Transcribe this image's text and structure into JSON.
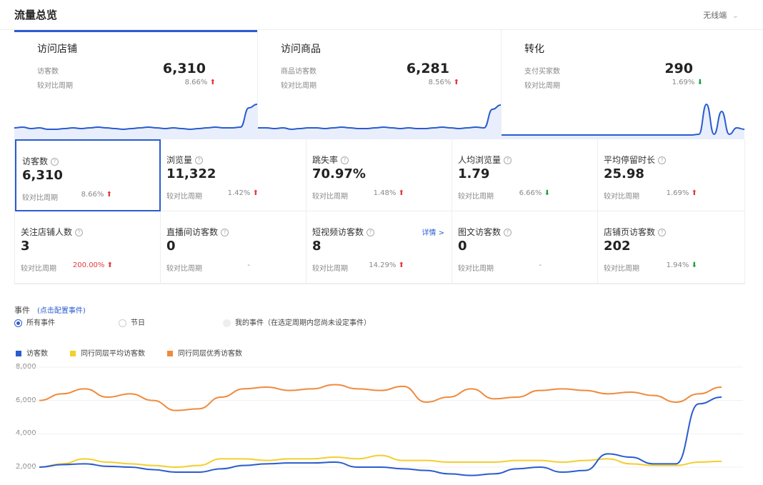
{
  "header": {
    "title": "流量总览",
    "device": "无线端"
  },
  "cards": [
    {
      "title": "访问店铺",
      "label": "访客数",
      "value": "6,310",
      "compare": "较对比周期",
      "pct": "8.66%",
      "dir": "up"
    },
    {
      "title": "访问商品",
      "label": "商品访客数",
      "value": "6,281",
      "compare": "较对比周期",
      "pct": "8.56%",
      "dir": "up"
    },
    {
      "title": "转化",
      "label": "支付买家数",
      "value": "290",
      "compare": "较对比周期",
      "pct": "1.69%",
      "dir": "down"
    }
  ],
  "metrics": [
    {
      "name": "访客数",
      "value": "6,310",
      "compare": "较对比周期",
      "pct": "8.66%",
      "dir": "up"
    },
    {
      "name": "浏览量",
      "value": "11,322",
      "compare": "较对比周期",
      "pct": "1.42%",
      "dir": "up"
    },
    {
      "name": "跳失率",
      "value": "70.97%",
      "compare": "较对比周期",
      "pct": "1.48%",
      "dir": "up"
    },
    {
      "name": "人均浏览量",
      "value": "1.79",
      "compare": "较对比周期",
      "pct": "6.66%",
      "dir": "down"
    },
    {
      "name": "平均停留时长",
      "value": "25.98",
      "compare": "较对比周期",
      "pct": "1.69%",
      "dir": "up"
    },
    {
      "name": "关注店铺人数",
      "value": "3",
      "compare": "较对比周期",
      "pct": "200.00%",
      "dir": "up"
    },
    {
      "name": "直播间访客数",
      "value": "0",
      "compare": "较对比周期",
      "pct": "-",
      "dir": "none"
    },
    {
      "name": "短视频访客数",
      "value": "8",
      "compare": "较对比周期",
      "pct": "14.29%",
      "dir": "up",
      "detail": "详情 >"
    },
    {
      "name": "图文访客数",
      "value": "0",
      "compare": "较对比周期",
      "pct": "-",
      "dir": "none"
    },
    {
      "name": "店铺页访客数",
      "value": "202",
      "compare": "较对比周期",
      "pct": "1.94%",
      "dir": "down"
    }
  ],
  "events": {
    "label": "事件",
    "link": "(点击配置事件)",
    "options": [
      "所有事件",
      "节日",
      "我的事件（在选定周期内您尚未设定事件）"
    ]
  },
  "colors": {
    "blue": "#2a5ccf",
    "yellow": "#f2cf2e",
    "orange": "#f08a3c",
    "up": "#e0393e",
    "down": "#1a9d3c"
  },
  "chart_data": {
    "type": "line",
    "ylim": [
      2000,
      8000
    ],
    "yticks": [
      "8,000",
      "6,000",
      "4,000",
      "2,000"
    ],
    "series": [
      {
        "name": "访客数",
        "color": "#2a5ccf",
        "values": [
          2000,
          2150,
          2200,
          2050,
          2000,
          1850,
          1700,
          1700,
          1900,
          2100,
          2200,
          2250,
          2250,
          2300,
          2000,
          2000,
          1900,
          1800,
          1600,
          1500,
          1600,
          1900,
          2000,
          1700,
          1800,
          2800,
          2600,
          2200,
          2200,
          5800,
          6200
        ]
      },
      {
        "name": "同行同层平均访客数",
        "color": "#f2cf2e",
        "values": [
          2000,
          2200,
          2500,
          2300,
          2200,
          2100,
          2000,
          2100,
          2500,
          2500,
          2400,
          2500,
          2500,
          2600,
          2500,
          2700,
          2400,
          2400,
          2300,
          2300,
          2300,
          2400,
          2400,
          2300,
          2400,
          2500,
          2200,
          2100,
          2100,
          2300,
          2350
        ]
      },
      {
        "name": "同行同层优秀访客数",
        "color": "#f08a3c",
        "values": [
          6000,
          6400,
          6700,
          6200,
          6400,
          6000,
          5400,
          5500,
          6200,
          6700,
          6800,
          6600,
          6700,
          6950,
          6700,
          6600,
          6850,
          5900,
          6200,
          6700,
          6100,
          6200,
          6600,
          6700,
          6600,
          6400,
          6500,
          6300,
          5900,
          6400,
          6800
        ]
      }
    ]
  },
  "sparklines": [
    [
      12,
      13,
      11,
      12,
      10,
      10,
      11,
      12,
      11,
      12,
      13,
      12,
      11,
      10,
      11,
      12,
      13,
      12,
      11,
      12,
      11,
      10,
      11,
      12,
      13,
      12,
      12,
      13,
      40,
      45
    ],
    [
      12,
      12,
      11,
      12,
      10,
      11,
      12,
      12,
      11,
      12,
      13,
      12,
      11,
      11,
      12,
      13,
      12,
      11,
      12,
      11,
      11,
      12,
      13,
      12,
      11,
      12,
      13,
      12,
      38,
      44
    ],
    [
      2,
      2,
      2,
      2,
      2,
      2,
      2,
      2,
      2,
      2,
      2,
      2,
      2,
      2,
      2,
      2,
      2,
      2,
      2,
      2,
      2,
      2,
      2,
      2,
      2,
      2,
      3,
      45,
      3,
      35,
      3,
      12,
      10
    ]
  ]
}
